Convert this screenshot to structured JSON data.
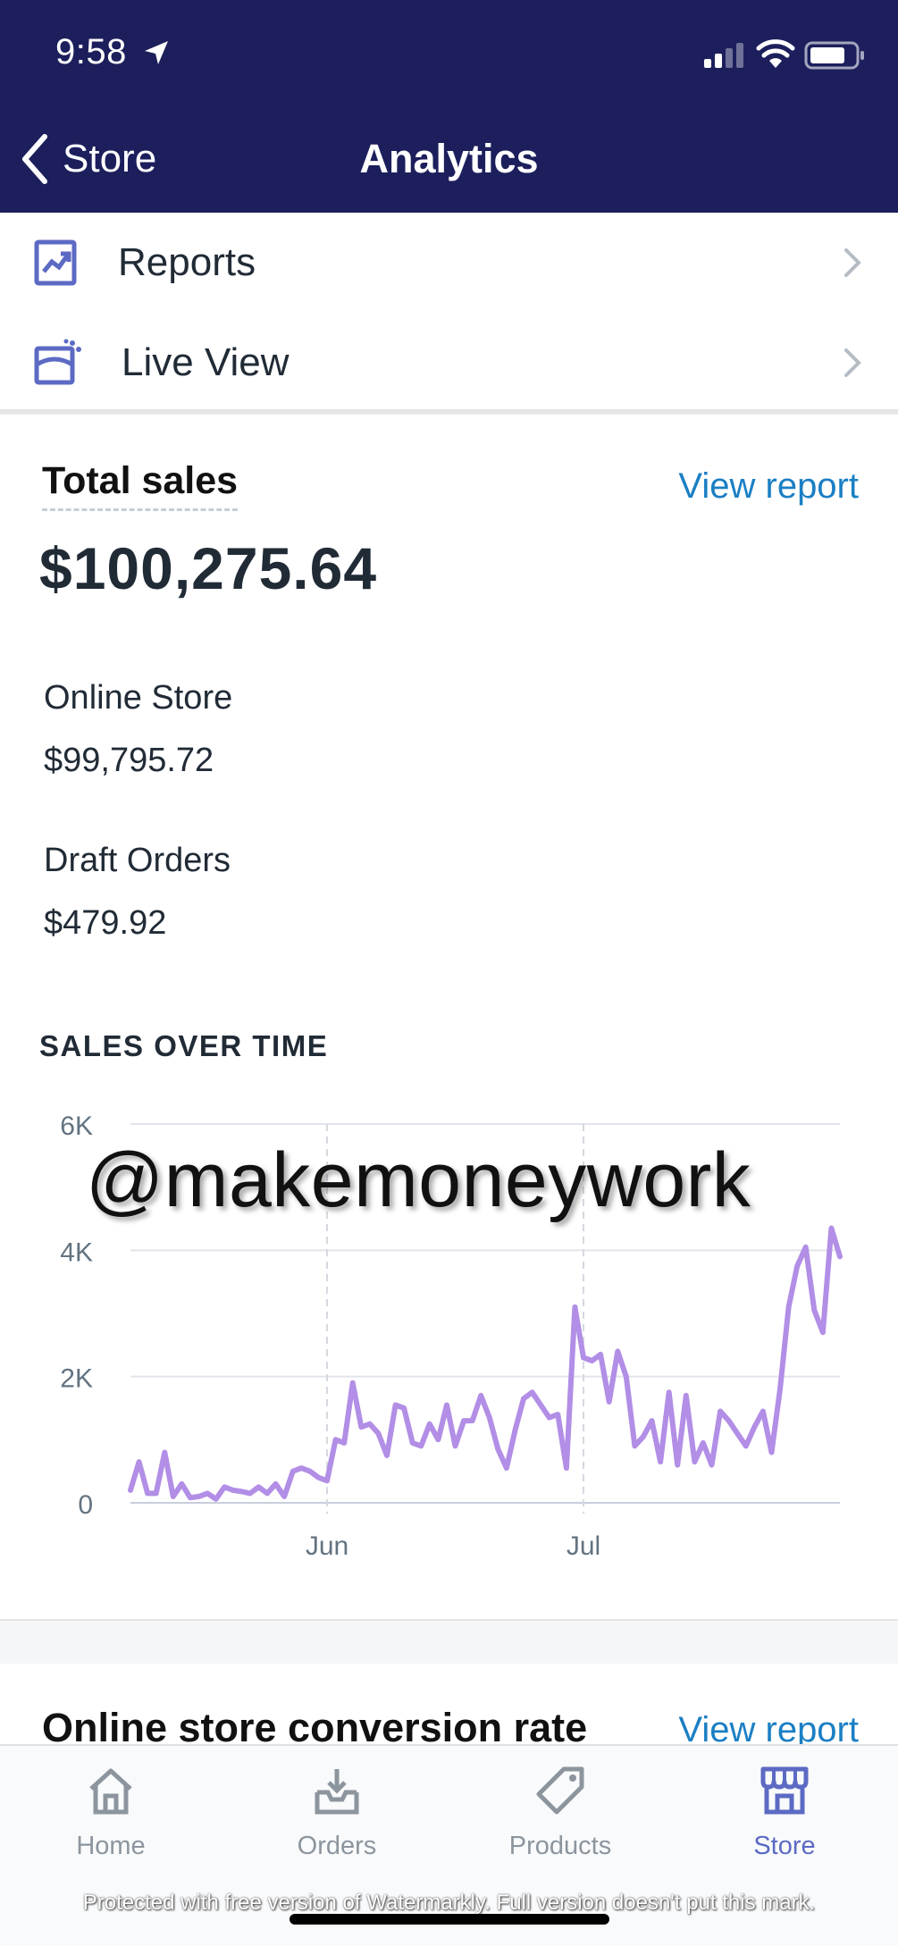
{
  "status_bar": {
    "time": "9:58"
  },
  "nav": {
    "back_label": "Store",
    "title": "Analytics"
  },
  "menu": [
    {
      "label": "Reports",
      "icon": "reports-chart-icon"
    },
    {
      "label": "Live View",
      "icon": "live-view-icon"
    }
  ],
  "total_sales": {
    "label": "Total sales",
    "view_report": "View report",
    "value": "$100,275.64",
    "channels": [
      {
        "name": "Online Store",
        "value": "$99,795.72"
      },
      {
        "name": "Draft Orders",
        "value": "$479.92"
      }
    ]
  },
  "sales_over_time": {
    "title": "SALES OVER TIME"
  },
  "chart_data": {
    "type": "line",
    "title": "SALES OVER TIME",
    "xlabel": "",
    "ylabel": "",
    "ylim": [
      0,
      6000
    ],
    "y_ticks": [
      "0",
      "2K",
      "4K",
      "6K"
    ],
    "x_tick_labels": [
      "Jun",
      "Jul"
    ],
    "x_tick_indices": [
      23,
      53
    ],
    "grid": true,
    "color": "#b28ee6",
    "series": [
      {
        "values": [
          200,
          650,
          150,
          150,
          800,
          100,
          300,
          80,
          100,
          150,
          60,
          250,
          200,
          180,
          150,
          250,
          150,
          300,
          100,
          500,
          550,
          500,
          400,
          350,
          1000,
          950,
          1900,
          1200,
          1250,
          1100,
          750,
          1550,
          1500,
          950,
          900,
          1250,
          1000,
          1550,
          900,
          1300,
          1300,
          1700,
          1350,
          850,
          550,
          1150,
          1650,
          1750,
          1550,
          1350,
          1400,
          550,
          3100,
          2300,
          2250,
          2350,
          1600,
          2400,
          2000,
          900,
          1050,
          1300,
          650,
          1750,
          600,
          1700,
          650,
          950,
          600,
          1450,
          1300,
          1100,
          900,
          1200,
          1450,
          800,
          1800,
          3100,
          3750,
          4050,
          3050,
          2700,
          4350,
          3900
        ]
      }
    ]
  },
  "watermark_overlay": "@makemoneywork",
  "conversion": {
    "title": "Online store conversion rate",
    "view_report": "View report"
  },
  "tabs": [
    {
      "label": "Home",
      "icon": "home-icon",
      "active": false
    },
    {
      "label": "Orders",
      "icon": "orders-icon",
      "active": false
    },
    {
      "label": "Products",
      "icon": "products-tag-icon",
      "active": false
    },
    {
      "label": "Store",
      "icon": "store-icon",
      "active": true
    }
  ],
  "footer_watermark": "Protected with free version of Watermarkly. Full version doesn't put this mark.",
  "colors": {
    "header_bg": "#1c1f5c",
    "accent": "#5c6ac4",
    "link": "#1b7fc4",
    "line": "#b28ee6"
  }
}
